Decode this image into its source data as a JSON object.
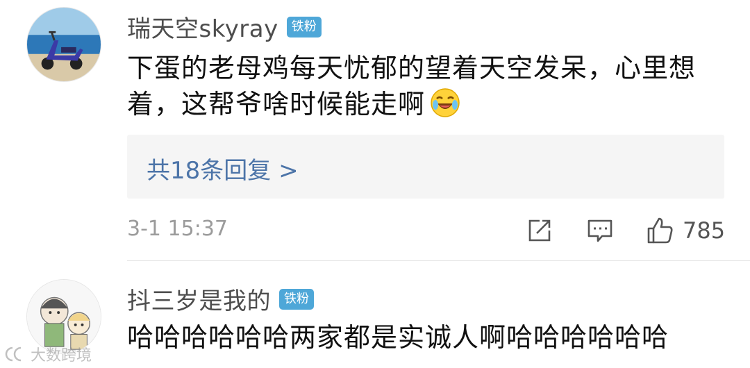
{
  "comments": [
    {
      "username": "瑞天空skyray",
      "badge": "铁粉",
      "text": "下蛋的老母鸡每天忧郁的望着天空发呆，心里想着，这帮爷啥时候能走啊",
      "emoji": "laugh-cry-emoji",
      "replies_label": "共18条回复 >",
      "timestamp": "3-1 15:37",
      "like_count": "785"
    },
    {
      "username": "抖三岁是我的",
      "badge": "铁粉",
      "text": "哈哈哈哈哈哈两家都是实诚人啊哈哈哈哈哈哈"
    }
  ],
  "icons": {
    "share": "share-icon",
    "comment": "comment-icon",
    "like": "thumbs-up-icon"
  },
  "colors": {
    "badge": "#4ea7d8",
    "reply_link": "#4c74a8",
    "reply_background": "#f5f5f5",
    "meta_text": "#9b9b9b"
  },
  "watermark": {
    "text": "大数跨境"
  }
}
